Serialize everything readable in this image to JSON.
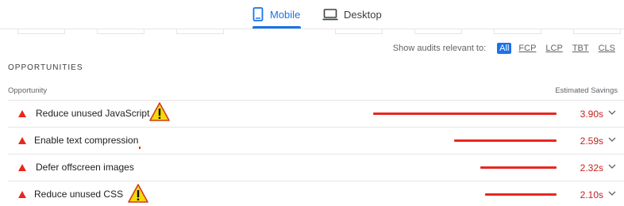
{
  "tabs": {
    "mobile": {
      "label": "Mobile",
      "icon": "smartphone-icon"
    },
    "desktop": {
      "label": "Desktop",
      "icon": "laptop-icon"
    }
  },
  "filter": {
    "label": "Show audits relevant to:",
    "chips": [
      "All",
      "FCP",
      "LCP",
      "TBT",
      "CLS"
    ],
    "active": "All"
  },
  "section": {
    "title": "OPPORTUNITIES",
    "col_opportunity": "Opportunity",
    "col_savings": "Estimated Savings"
  },
  "colors": {
    "accent": "#1a73e8",
    "fail": "#e8271e",
    "savings_text": "#c5221f",
    "warning_fill": "#f5d90a"
  },
  "rows": [
    {
      "title": "Reduce unused JavaScript",
      "savings": "3.90s",
      "savings_seconds": 3.9,
      "warning": true
    },
    {
      "title": "Enable text compression",
      "savings": "2.59s",
      "savings_seconds": 2.59,
      "warning": false
    },
    {
      "title": "Defer offscreen images",
      "savings": "2.32s",
      "savings_seconds": 2.32,
      "warning": false
    },
    {
      "title": "Reduce unused CSS",
      "savings": "2.10s",
      "savings_seconds": 2.1,
      "warning": true
    }
  ]
}
